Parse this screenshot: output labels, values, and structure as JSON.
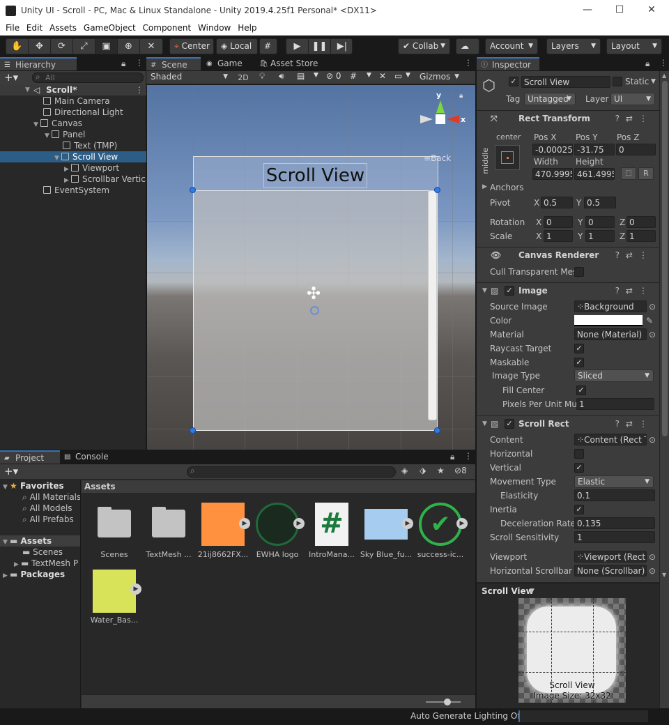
{
  "window": {
    "title": "Unity UI - Scroll - PC, Mac & Linux Standalone - Unity 2019.4.25f1 Personal* <DX11>"
  },
  "menu": [
    "File",
    "Edit",
    "Assets",
    "GameObject",
    "Component",
    "Window",
    "Help"
  ],
  "toolbar": {
    "center": "Center",
    "local": "Local",
    "collab": "Collab",
    "account": "Account",
    "layers": "Layers",
    "layout": "Layout"
  },
  "hierarchy": {
    "tab": "Hierarchy",
    "search_placeholder": "All",
    "items": [
      {
        "label": "Scroll*"
      },
      {
        "label": "Main Camera"
      },
      {
        "label": "Directional Light"
      },
      {
        "label": "Canvas"
      },
      {
        "label": "Panel"
      },
      {
        "label": "Text (TMP)"
      },
      {
        "label": "Scroll View"
      },
      {
        "label": "Viewport"
      },
      {
        "label": "Scrollbar Vertica"
      },
      {
        "label": "EventSystem"
      }
    ]
  },
  "scene": {
    "tabs": [
      "Scene",
      "Game",
      "Asset Store"
    ],
    "shading": "Shaded",
    "mode2d": "2D",
    "hidden_count": "0",
    "gizmos": "Gizmos",
    "scroll_view_text": "Scroll View",
    "axis_y": "y",
    "axis_x": "x",
    "back_label": "Back"
  },
  "inspector": {
    "tab": "Inspector",
    "object_name": "Scroll View",
    "static_label": "Static",
    "tag_label": "Tag",
    "tag_value": "Untagged",
    "layer_label": "Layer",
    "layer_value": "UI",
    "rect_transform": {
      "title": "Rect Transform",
      "anchor_h": "center",
      "anchor_v": "middle",
      "posx_label": "Pos X",
      "posy_label": "Pos Y",
      "posz_label": "Pos Z",
      "posx": "-0.00025",
      "posy": "-31.75",
      "posz": "0",
      "width_label": "Width",
      "height_label": "Height",
      "width": "470.9995",
      "height": "461.4995",
      "r_btn": "R",
      "anchors": "Anchors",
      "pivot_label": "Pivot",
      "pivot_x": "0.5",
      "pivot_y": "0.5",
      "rotation_label": "Rotation",
      "rot_x": "0",
      "rot_y": "0",
      "rot_z": "0",
      "scale_label": "Scale",
      "scale_x": "1",
      "scale_y": "1",
      "scale_z": "1",
      "x": "X",
      "y": "Y",
      "z": "Z"
    },
    "canvas_renderer": {
      "title": "Canvas Renderer",
      "cull_label": "Cull Transparent Mes"
    },
    "image": {
      "title": "Image",
      "source_label": "Source Image",
      "source_value": "Background",
      "color_label": "Color",
      "material_label": "Material",
      "material_value": "None (Material)",
      "raycast_label": "Raycast Target",
      "maskable_label": "Maskable",
      "type_label": "Image Type",
      "type_value": "Sliced",
      "fill_label": "Fill Center",
      "ppu_label": "Pixels Per Unit Mul",
      "ppu_value": "1"
    },
    "scroll_rect": {
      "title": "Scroll Rect",
      "content_label": "Content",
      "content_value": "Content (Rect T",
      "horizontal_label": "Horizontal",
      "vertical_label": "Vertical",
      "movement_label": "Movement Type",
      "movement_value": "Elastic",
      "elasticity_label": "Elasticity",
      "elasticity_value": "0.1",
      "inertia_label": "Inertia",
      "decel_label": "Deceleration Rate",
      "decel_value": "0.135",
      "sensitivity_label": "Scroll Sensitivity",
      "sensitivity_value": "1",
      "viewport_label": "Viewport",
      "viewport_value": "Viewport (Rect",
      "hscroll_label": "Horizontal Scrollbar",
      "hscroll_value": "None (Scrollbar)"
    },
    "preview": {
      "title": "Scroll View",
      "name": "Scroll View",
      "size": "Image Size: 32x32"
    }
  },
  "project": {
    "tabs": [
      "Project",
      "Console"
    ],
    "hidden_count": "8",
    "favorites": "Favorites",
    "fav_items": [
      "All Materials",
      "All Models",
      "All Prefabs"
    ],
    "assets_root": "Assets",
    "asset_folders": [
      "Scenes",
      "TextMesh P"
    ],
    "packages": "Packages",
    "breadcrumb": "Assets",
    "assets": [
      {
        "label": "Scenes"
      },
      {
        "label": "TextMesh ..."
      },
      {
        "label": "21ij8662FX..."
      },
      {
        "label": "EWHA logo"
      },
      {
        "label": "IntroMana..."
      },
      {
        "label": "Sky Blue_fu..."
      },
      {
        "label": "success-ic..."
      },
      {
        "label": "Water_Bas..."
      }
    ]
  },
  "status": {
    "text": "Auto Generate Lighting Off"
  }
}
